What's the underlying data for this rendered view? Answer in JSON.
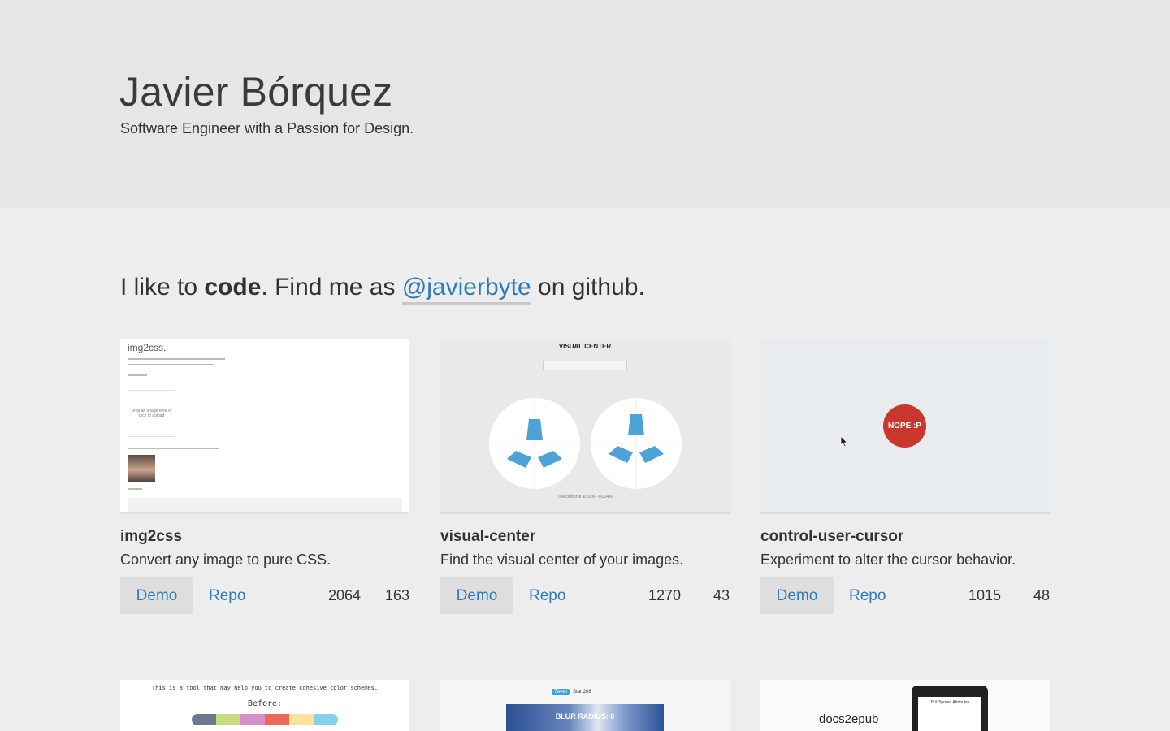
{
  "header": {
    "name": "Javier Bórquez",
    "tagline": "Software Engineer with a Passion for Design."
  },
  "intro": {
    "part1": "I like to ",
    "bold": "code",
    "part2": ". Find me as ",
    "link": "@javierbyte",
    "part3": " on github."
  },
  "projects": [
    {
      "title": "img2css",
      "description": "Convert any image to pure CSS.",
      "demo_label": "Demo",
      "repo_label": "Repo",
      "stars": "2064",
      "forks": "163",
      "thumb": {
        "logo": "img2css.",
        "drop_text": "Drop an image here or click to upload"
      }
    },
    {
      "title": "visual-center",
      "description": "Find the visual center of your images.",
      "demo_label": "Demo",
      "repo_label": "Repo",
      "stars": "1270",
      "forks": "43",
      "thumb": {
        "heading": "VISUAL CENTER",
        "bottom_text": "The center is at 50% - 60.24%"
      }
    },
    {
      "title": "control-user-cursor",
      "description": "Experiment to alter the cursor behavior.",
      "demo_label": "Demo",
      "repo_label": "Repo",
      "stars": "1015",
      "forks": "48",
      "thumb": {
        "button": "NOPE :P"
      }
    }
  ],
  "row2": {
    "color_tool": {
      "text": "This is a tool that may help you to create cohesive color schemes.",
      "before": "Before:",
      "swatches": [
        "#6b7a8f",
        "#c5dc80",
        "#d690c5",
        "#e96a5b",
        "#f9e49a",
        "#85d0ea"
      ]
    },
    "blur": {
      "tweet": "Tweet",
      "star": "Star",
      "count": "208",
      "label": "BLUR RADIUS: 0"
    },
    "docs2epub": {
      "name": "docs2epub",
      "screen_title": "JSX Spread Attributes"
    }
  },
  "colors": {
    "link": "#2b7bb9",
    "nope": "#c8372d"
  }
}
